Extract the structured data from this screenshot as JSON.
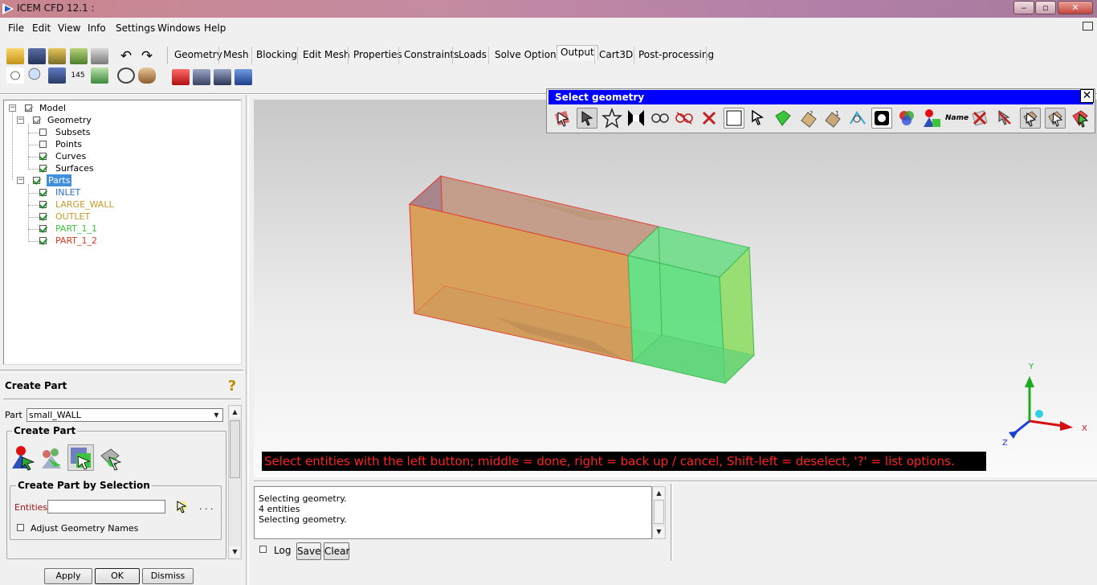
{
  "window": {
    "title": "ICEM CFD 12.1 :",
    "minimize": "‒",
    "maximize": "▫",
    "close": "✕"
  },
  "menu": [
    "File",
    "Edit",
    "View",
    "Info",
    "Settings",
    "Windows",
    "Help"
  ],
  "tabs": [
    "Geometry",
    "Mesh",
    "Blocking",
    "Edit Mesh",
    "Properties",
    "Constraints",
    "Loads",
    "Solve Options",
    "Output",
    "Cart3D",
    "Post-processing"
  ],
  "active_tab": "Output",
  "tree": {
    "root": "Model",
    "geometry": "Geometry",
    "geometry_children": [
      "Subsets",
      "Points",
      "Curves",
      "Surfaces"
    ],
    "parts": "Parts",
    "parts_children": [
      {
        "label": "INLET",
        "color": "#2a6fc7"
      },
      {
        "label": "LARGE_WALL",
        "color": "#c69a2a"
      },
      {
        "label": "OUTLET",
        "color": "#c69a2a"
      },
      {
        "label": "PART_1_1",
        "color": "#3ec33e"
      },
      {
        "label": "PART_1_2",
        "color": "#d43a1a"
      }
    ]
  },
  "create_part": {
    "title": "Create Part",
    "part_label": "Part",
    "part_value": "small_WALL",
    "group_title": "Create Part",
    "selection_title": "Create Part by Selection",
    "entities_label": "Entities",
    "entities_value": "",
    "dots": ". . .",
    "adjust_label": "Adjust Geometry Names",
    "apply": "Apply",
    "ok": "OK",
    "dismiss": "Dismiss"
  },
  "select_geometry": {
    "title": "Select geometry",
    "close": "✕",
    "name_label": "Name"
  },
  "status_message": "Select entities with the left button; middle = done, right = back up / cancel, Shift-left = deselect, '?' = list options.",
  "console": {
    "lines": [
      "Selecting geometry.",
      "4 entities",
      "Selecting geometry."
    ],
    "log_label": "Log",
    "save": "Save",
    "clear": "Clear"
  },
  "axes": {
    "x": "X",
    "y": "Y",
    "z": "Z"
  },
  "colors": {
    "title_accent": "#0000ff",
    "box_orange": "#d9a05c",
    "box_green": "#5fe07e",
    "edge_red": "#e23c2c"
  }
}
